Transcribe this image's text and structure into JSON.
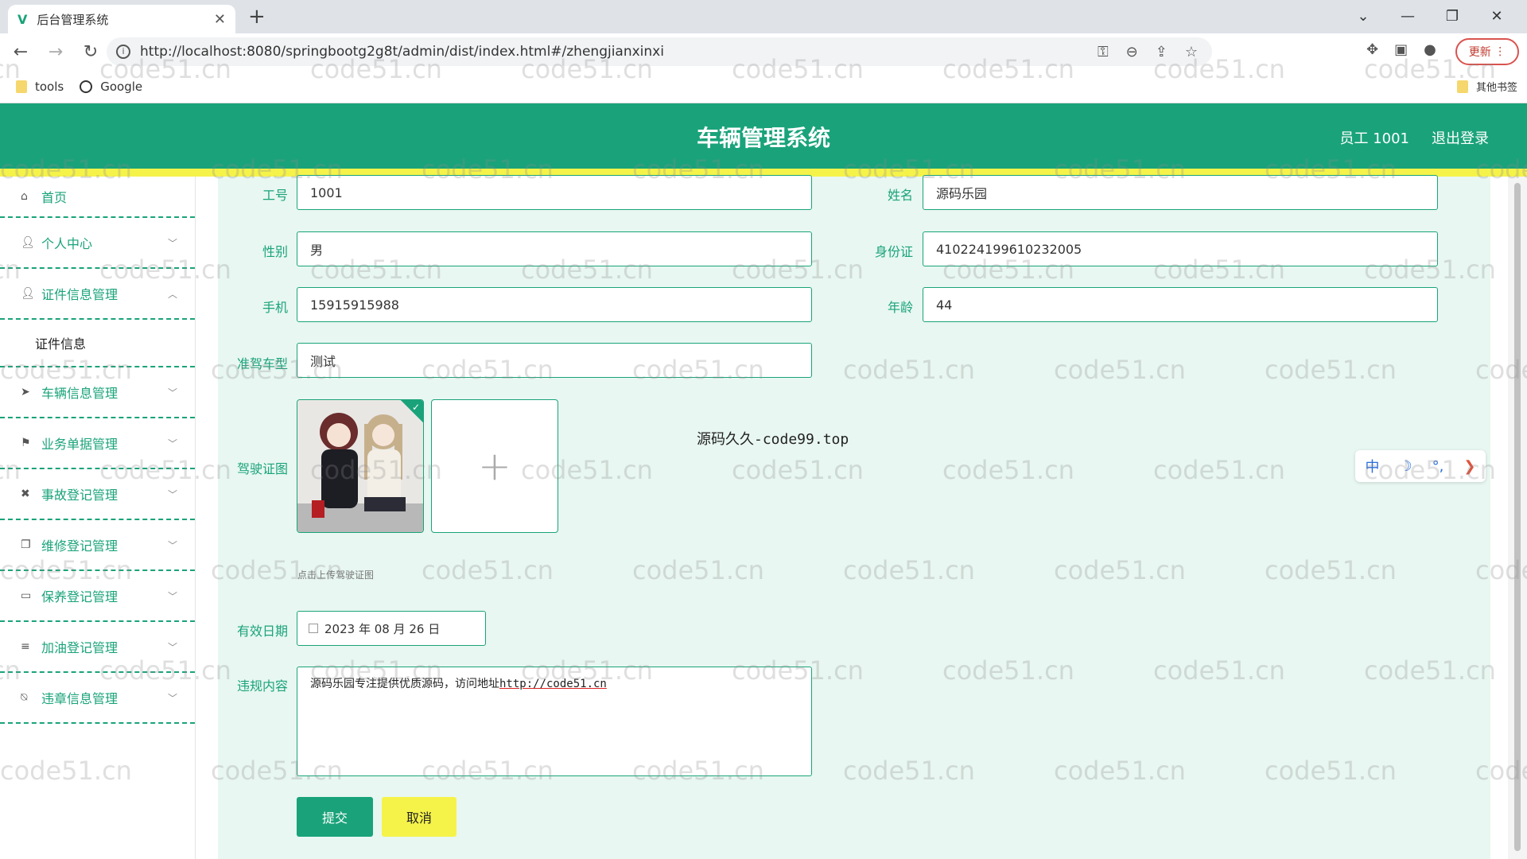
{
  "browser": {
    "tab_title": "后台管理系统",
    "tab_favicon": "V",
    "new_tab": "+",
    "url": "http://localhost:8080/springbootg2g8t/admin/dist/index.html#/zhengjianxinxi",
    "update_label": "更新",
    "bookmarks": [
      "tools",
      "Google"
    ],
    "other_bookmarks": "其他书签"
  },
  "app": {
    "title": "车辆管理系统",
    "user": "员工 1001",
    "logout": "退出登录",
    "accent": "#1aa37a",
    "secondary": "#f5f34a"
  },
  "sidebar": {
    "items": [
      {
        "label": "首页",
        "icon": "home-icon"
      },
      {
        "label": "个人中心",
        "icon": "user-icon"
      },
      {
        "label": "证件信息管理",
        "icon": "user-icon"
      },
      {
        "label": "车辆信息管理",
        "icon": "send-icon"
      },
      {
        "label": "业务单据管理",
        "icon": "flag-icon"
      },
      {
        "label": "事故登记管理",
        "icon": "crossed-icon"
      },
      {
        "label": "维修登记管理",
        "icon": "copy-icon"
      },
      {
        "label": "保养登记管理",
        "icon": "message-icon"
      },
      {
        "label": "加油登记管理",
        "icon": "list-icon"
      },
      {
        "label": "违章信息管理",
        "icon": "bell-off-icon"
      }
    ],
    "subitem": "证件信息"
  },
  "form": {
    "labels": {
      "gonghao": "工号",
      "xingming": "姓名",
      "xingbie": "性别",
      "shenfenzheng": "身份证",
      "shouji": "手机",
      "nianling": "年龄",
      "zhunjia": "准驾车型",
      "jiashizheng": "驾驶证图",
      "youxiaoriqi": "有效日期",
      "weigui": "违规内容"
    },
    "values": {
      "gonghao": "1001",
      "xingming": "源码乐园",
      "xingbie": "男",
      "shenfenzheng": "410224199610232005",
      "shouji": "15915915988",
      "nianling": "44",
      "zhunjia": "测试",
      "youxiaoriqi": "2023 年 08 月 26 日",
      "weigui_text": "源码乐园专注提供优质源码，访问地址",
      "weigui_link": "http://code51.cn"
    },
    "upload_tip": "点击上传驾驶证图",
    "upload_plus": "+",
    "overlay_text": "源码久久-code99.top",
    "submit": "提交",
    "cancel": "取消"
  },
  "ime": {
    "lang": "中",
    "moon": "☽",
    "dots": "°,",
    "arrow": "❯"
  },
  "watermark": "code51.cn"
}
